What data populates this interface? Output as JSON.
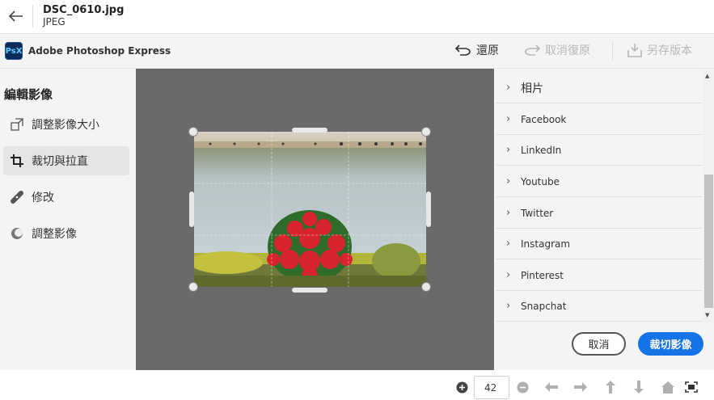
{
  "titlebar": {
    "file_name": "DSC_0610.jpg",
    "file_type": "JPEG"
  },
  "appbar": {
    "logo_text": "PsX",
    "app_name": "Adobe Photoshop Express",
    "undo_label": "還原",
    "redo_label": "取消復原",
    "save_as_label": "另存版本"
  },
  "sidebar": {
    "title": "編輯影像",
    "items": [
      {
        "label": "調整影像大小",
        "icon": "resize-icon"
      },
      {
        "label": "裁切與拉直",
        "icon": "crop-icon",
        "active": true
      },
      {
        "label": "修改",
        "icon": "bandage-icon"
      },
      {
        "label": "調整影像",
        "icon": "adjust-icon"
      }
    ]
  },
  "size_list": {
    "items": [
      "相片",
      "Facebook",
      "LinkedIn",
      "Youtube",
      "Twitter",
      "Instagram",
      "Pinterest",
      "Snapchat"
    ]
  },
  "actions": {
    "cancel_label": "取消",
    "crop_label": "裁切影像"
  },
  "bottombar": {
    "zoom_value": "42"
  },
  "colors": {
    "accent": "#1473e6",
    "canvas_bg": "#6a6a6a",
    "panel_bg": "#f4f4f4"
  }
}
